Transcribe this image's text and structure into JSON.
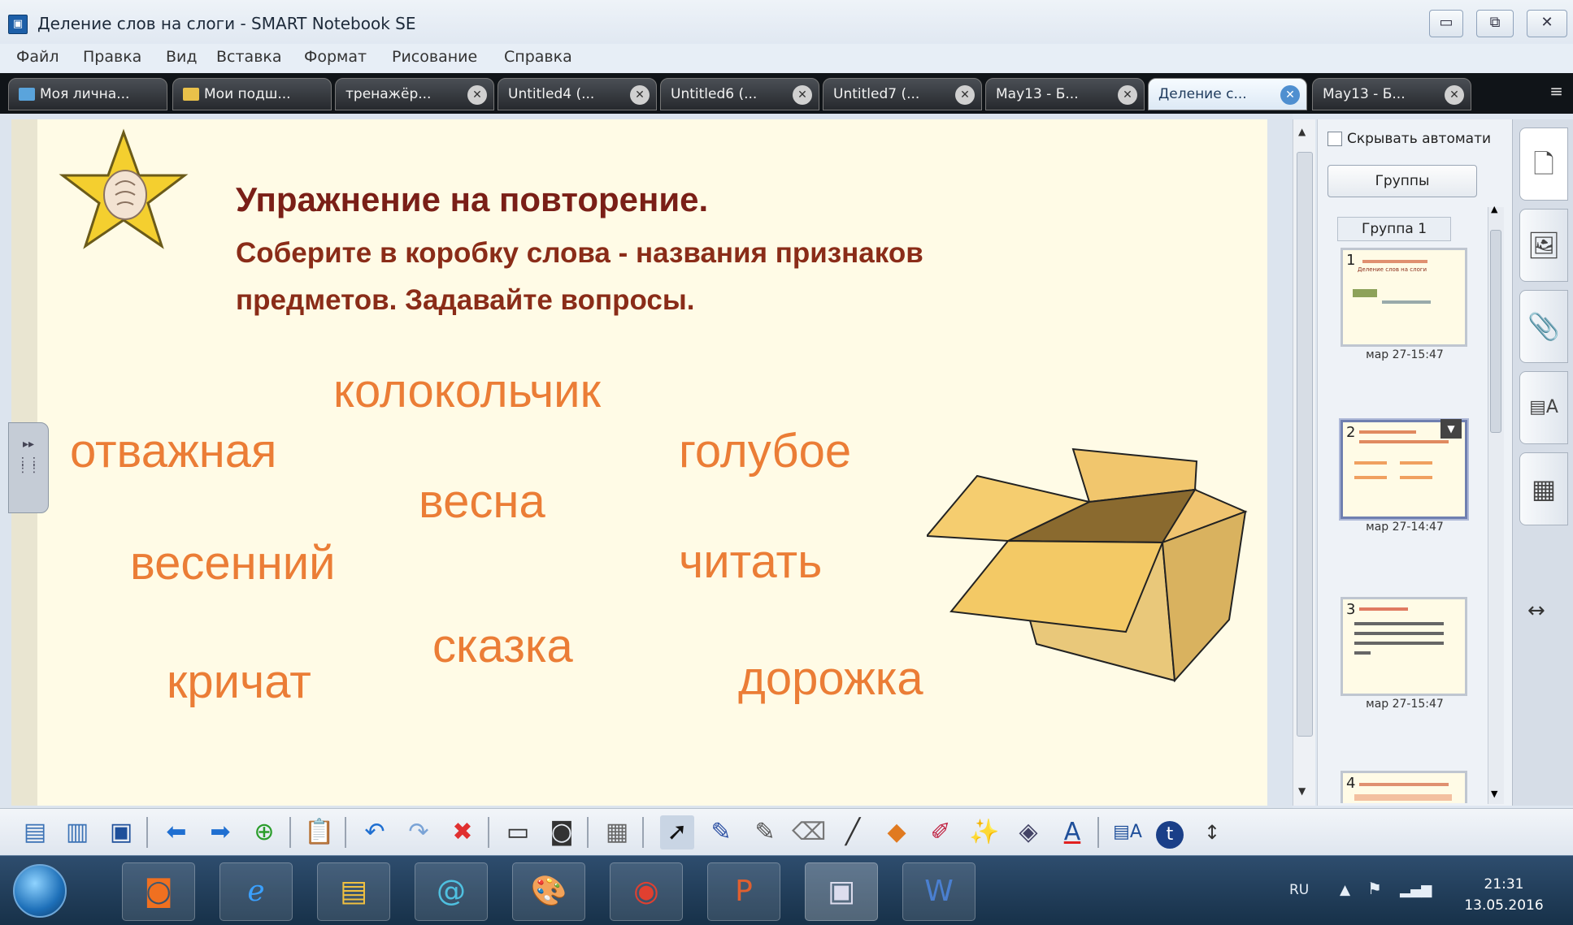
{
  "window": {
    "title": "Деление слов на слоги - SMART Notebook SE"
  },
  "menu": [
    "Файл",
    "Правка",
    "Вид",
    "Вставка",
    "Формат",
    "Рисование",
    "Справка"
  ],
  "tabs": [
    {
      "label": "Моя лична...",
      "closable": false
    },
    {
      "label": "Мои подш...",
      "closable": false
    },
    {
      "label": "тренажёр...",
      "closable": true
    },
    {
      "label": "Untitled4 (...",
      "closable": true
    },
    {
      "label": "Untitled6 (...",
      "closable": true
    },
    {
      "label": "Untitled7 (...",
      "closable": true
    },
    {
      "label": "May13 - Б...",
      "closable": true
    },
    {
      "label": "Деление с...",
      "closable": true,
      "active": true
    },
    {
      "label": "May13 - Б...",
      "closable": true
    }
  ],
  "slide": {
    "heading": "Упражнение на повторение.",
    "sub_line1": "Соберите в коробку слова - названия признаков",
    "sub_line2": "предметов. Задавайте вопросы.",
    "words": {
      "w1": "колокольчик",
      "w2": "отважная",
      "w3": "голубое",
      "w4": "весна",
      "w5": "весенний",
      "w6": "читать",
      "w7": "сказка",
      "w8": "кричат",
      "w9": "дорожка"
    }
  },
  "sorter": {
    "autohide_label": "Скрывать автомати",
    "groups_button": "Группы",
    "group_label": "Группа 1",
    "pages": [
      {
        "num": "1",
        "date": "мар 27-15:47",
        "caption": "Деление слов на слоги"
      },
      {
        "num": "2",
        "date": "мар 27-14:47"
      },
      {
        "num": "3",
        "date": "мар 27-15:47"
      },
      {
        "num": "4"
      }
    ]
  },
  "taskbar": {
    "lang": "RU",
    "time": "21:31",
    "date": "13.05.2016"
  },
  "colors": {
    "slide_bg": "#fffbe6",
    "heading": "#7a1f17",
    "word": "#eb7d36",
    "active_tab": "#dde9f5"
  }
}
